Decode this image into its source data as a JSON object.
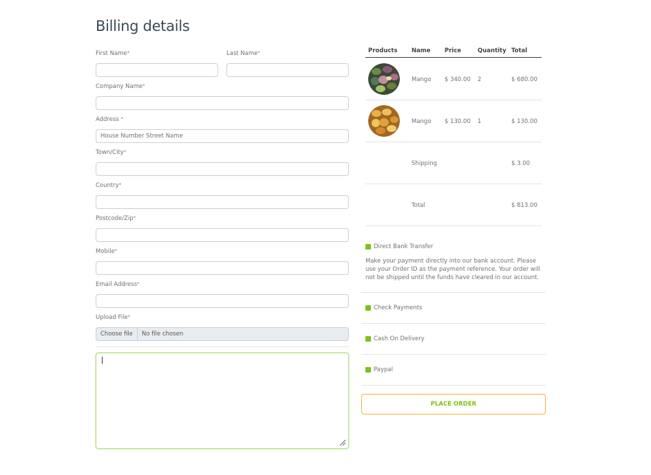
{
  "page_title": "Billing details",
  "form": {
    "first_name_label": "First Name",
    "last_name_label": "Last Name",
    "company_label": "Company Name",
    "address_label": "Address ",
    "address_placeholder": "House Number Street Name",
    "town_label": "Town/City",
    "country_label": "Country",
    "postcode_label": "Postcode/Zip",
    "mobile_label": "Mobile",
    "email_label": "Email Address",
    "upload_label": "Upload File",
    "file_button": "Choose file",
    "file_status": "No file chosen",
    "required_mark": "*"
  },
  "order_table": {
    "headers": [
      "Products",
      "Name",
      "Price",
      "Quantity",
      "Total"
    ],
    "rows": [
      {
        "name": "Mango",
        "price": "$ 340.00",
        "quantity": "2",
        "total": "$ 680.00"
      },
      {
        "name": "Mango",
        "price": "$ 130.00",
        "quantity": "1",
        "total": "$ 130.00"
      }
    ],
    "shipping_label": "Shipping",
    "shipping_value": "$ 3.00",
    "total_label": "Total",
    "total_value": "$ 813.00"
  },
  "payment": {
    "direct_bank": "Direct Bank Transfer",
    "direct_bank_desc": "Make your payment directly into our bank account. Please use your Order ID as the payment reference. Your order will not be shipped until the funds have cleared in our account.",
    "check": "Check Payments",
    "cod": "Cash On Delivery",
    "paypal": "Paypal",
    "accent_color": "#7cc219"
  },
  "place_order_label": "PLACE ORDER"
}
